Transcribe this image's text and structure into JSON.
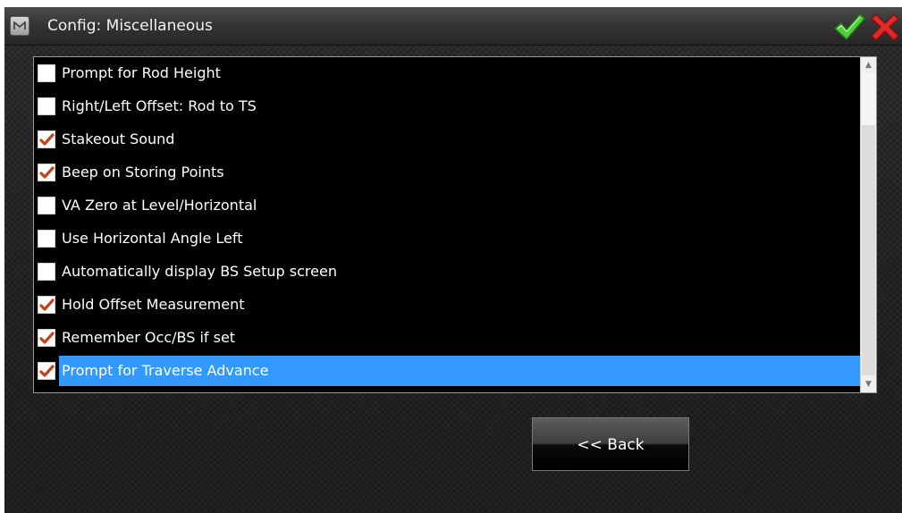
{
  "window": {
    "title": "Config: Miscellaneous",
    "app_icon": "app-logo-icon",
    "ok_icon": "green-checkmark-icon",
    "cancel_icon": "red-x-icon"
  },
  "options": [
    {
      "label": "Prompt for Rod Height",
      "checked": false,
      "selected": false
    },
    {
      "label": "Right/Left Offset: Rod to TS",
      "checked": false,
      "selected": false
    },
    {
      "label": "Stakeout Sound",
      "checked": true,
      "selected": false
    },
    {
      "label": "Beep on Storing Points",
      "checked": true,
      "selected": false
    },
    {
      "label": "VA Zero at Level/Horizontal",
      "checked": false,
      "selected": false
    },
    {
      "label": "Use Horizontal Angle Left",
      "checked": false,
      "selected": false
    },
    {
      "label": "Automatically display BS Setup screen",
      "checked": false,
      "selected": false
    },
    {
      "label": "Hold Offset Measurement",
      "checked": true,
      "selected": false
    },
    {
      "label": "Remember Occ/BS if set",
      "checked": true,
      "selected": false
    },
    {
      "label": "Prompt for Traverse Advance",
      "checked": true,
      "selected": true
    }
  ],
  "back_button": {
    "label": "<< Back"
  },
  "colors": {
    "selection": "#3399ff",
    "checkmark": "#c0431c",
    "list_background": "#000000"
  }
}
